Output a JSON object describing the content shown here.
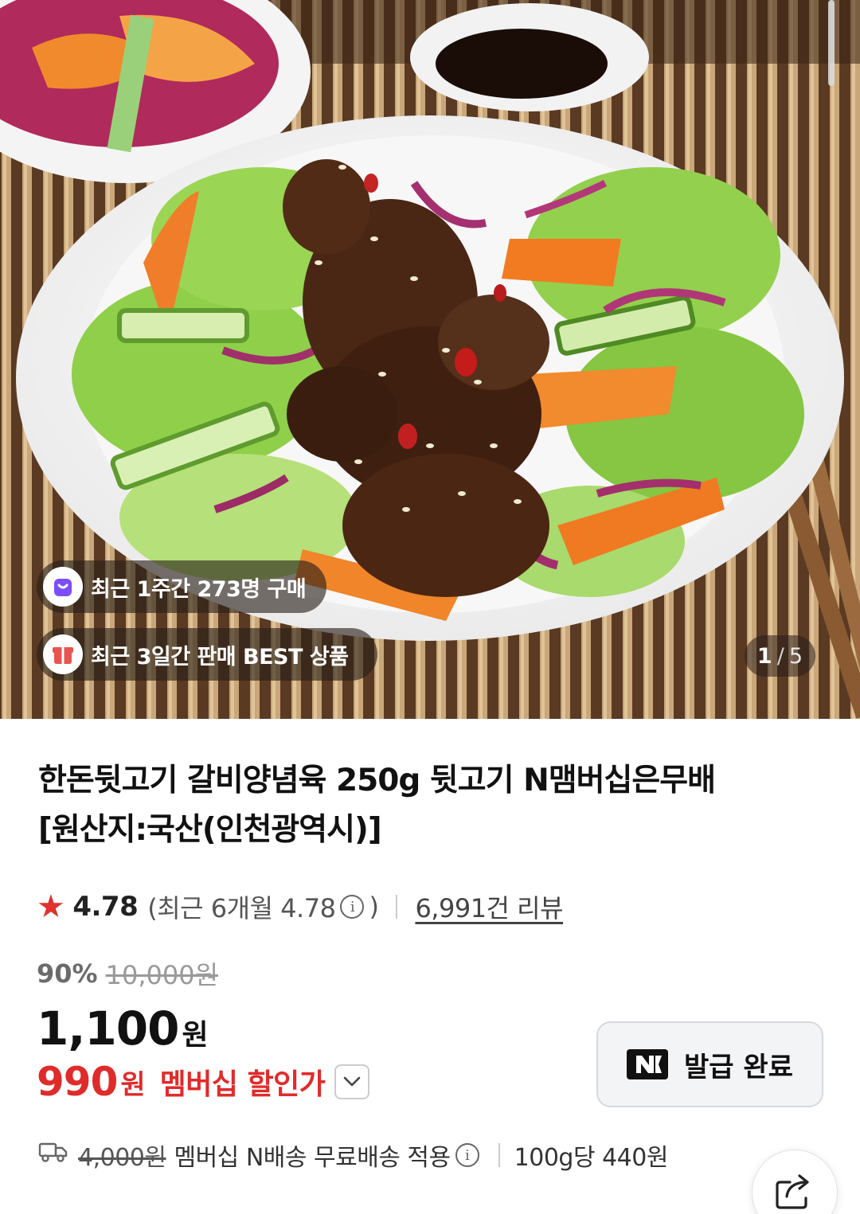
{
  "hero": {
    "badges": [
      {
        "icon": "shopping-bag-icon",
        "text": "최근 1주간 273명 구매"
      },
      {
        "icon": "gift-box-icon",
        "text": "최근 3일간 판매 BEST 상품"
      }
    ],
    "pager": {
      "current": "1",
      "separator": "/",
      "total": "5"
    }
  },
  "product": {
    "title_line1": "한돈뒷고기 갈비양념육 250g 뒷고기 N맴버십은무배",
    "title_line2": "[원산지:국산(인천광역시)]",
    "rating": "4.78",
    "rating_recent": "(최근 6개월 4.78",
    "rating_recent_close": ")",
    "reviews": "6,991건 리뷰",
    "discount_rate": "90%",
    "original_price": "10,000원",
    "price": "1,100",
    "price_unit": "원",
    "member_price": "990",
    "member_unit": "원",
    "member_label": "멤버십 할인가"
  },
  "coupon": {
    "label": "발급 완료"
  },
  "shipping": {
    "old_fee": "4,000원",
    "text": "멤버십 N배송 무료배송 적용",
    "per_unit": "100g당 440원"
  },
  "colors": {
    "accent_red": "#e02b2b",
    "star": "#e0332d",
    "badge_purple": "#7b4dff",
    "badge_red": "#e8554f"
  }
}
